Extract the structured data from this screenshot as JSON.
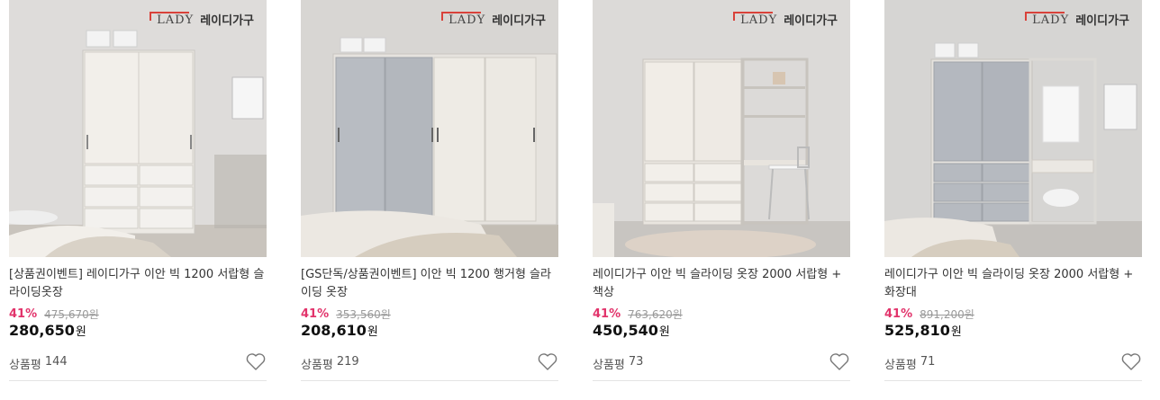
{
  "brand": {
    "lady": "LADY",
    "korean": "레이디가구"
  },
  "currency_unit": "원",
  "review_label": "상품평",
  "products": [
    {
      "name": "[상품권이벤트] 레이디가구 이안 빅 1200 서랍형 슬라이딩옷장",
      "discount": "41%",
      "original_price": "475,670원",
      "price": "280,650",
      "reviews": "144"
    },
    {
      "name": "[GS단독/상품권이벤트] 이안 빅 1200 행거형 슬라이딩 옷장",
      "discount": "41%",
      "original_price": "353,560원",
      "price": "208,610",
      "reviews": "219"
    },
    {
      "name": "레이디가구 이안 빅 슬라이딩 옷장 2000 서랍형 + 책상",
      "discount": "41%",
      "original_price": "763,620원",
      "price": "450,540",
      "reviews": "73"
    },
    {
      "name": "레이디가구 이안 빅 슬라이딩 옷장 2000 서랍형 + 화장대",
      "discount": "41%",
      "original_price": "891,200원",
      "price": "525,810",
      "reviews": "71"
    }
  ],
  "icons": {
    "wishlist": "heart-outline-icon"
  },
  "colors": {
    "discount": "#e2336b",
    "brand_accent": "#d9423a"
  }
}
